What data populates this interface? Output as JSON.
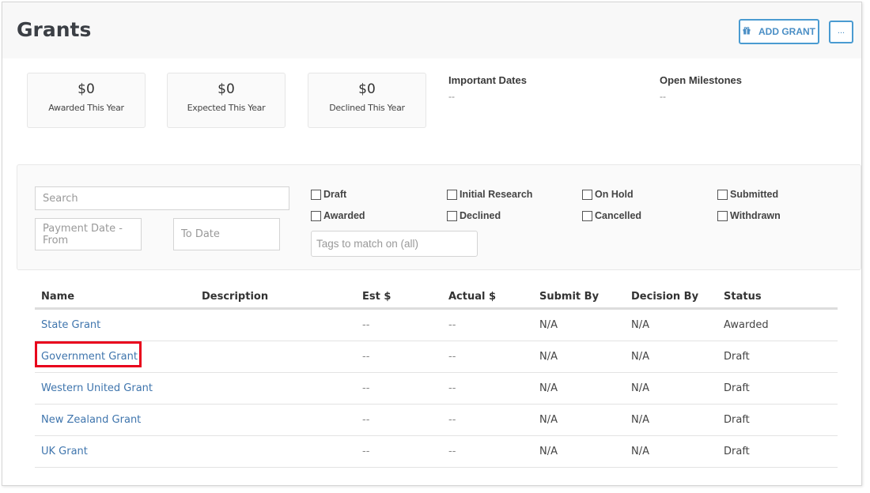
{
  "header": {
    "title": "Grants",
    "add_button_label": "ADD GRANT",
    "add_button_icon": "gift-icon",
    "more_button_label": "..."
  },
  "stats": [
    {
      "value": "$0",
      "label": "Awarded This Year"
    },
    {
      "value": "$0",
      "label": "Expected This Year"
    },
    {
      "value": "$0",
      "label": "Declined This Year"
    }
  ],
  "info": {
    "important_dates": {
      "heading": "Important Dates",
      "value": "--"
    },
    "open_milestones": {
      "heading": "Open Milestones",
      "value": "--"
    }
  },
  "filters": {
    "search_placeholder": "Search",
    "date_from_placeholder": "Payment Date -From",
    "date_to_placeholder": "To Date",
    "tags_placeholder": "Tags to match on (all)",
    "statuses": [
      {
        "label": "Draft",
        "checked": false
      },
      {
        "label": "Initial Research",
        "checked": false
      },
      {
        "label": "On Hold",
        "checked": false
      },
      {
        "label": "Submitted",
        "checked": false
      },
      {
        "label": "Awarded",
        "checked": false
      },
      {
        "label": "Declined",
        "checked": false
      },
      {
        "label": "Cancelled",
        "checked": false
      },
      {
        "label": "Withdrawn",
        "checked": false
      }
    ]
  },
  "table": {
    "columns": [
      "Name",
      "Description",
      "Est $",
      "Actual $",
      "Submit By",
      "Decision By",
      "Status"
    ],
    "rows": [
      {
        "name": "State Grant",
        "description": "",
        "est": "--",
        "actual": "--",
        "submit_by": "N/A",
        "decision_by": "N/A",
        "status": "Awarded"
      },
      {
        "name": "Government Grant",
        "description": "",
        "est": "--",
        "actual": "--",
        "submit_by": "N/A",
        "decision_by": "N/A",
        "status": "Draft"
      },
      {
        "name": "Western United Grant",
        "description": "",
        "est": "--",
        "actual": "--",
        "submit_by": "N/A",
        "decision_by": "N/A",
        "status": "Draft"
      },
      {
        "name": "New Zealand Grant",
        "description": "",
        "est": "--",
        "actual": "--",
        "submit_by": "N/A",
        "decision_by": "N/A",
        "status": "Draft"
      },
      {
        "name": "UK Grant",
        "description": "",
        "est": "--",
        "actual": "--",
        "submit_by": "N/A",
        "decision_by": "N/A",
        "status": "Draft"
      }
    ]
  },
  "highlight": {
    "target": "Government Grant",
    "color": "#e8001c"
  },
  "colors": {
    "accent": "#4a9bd1",
    "link": "#3f75ad"
  }
}
